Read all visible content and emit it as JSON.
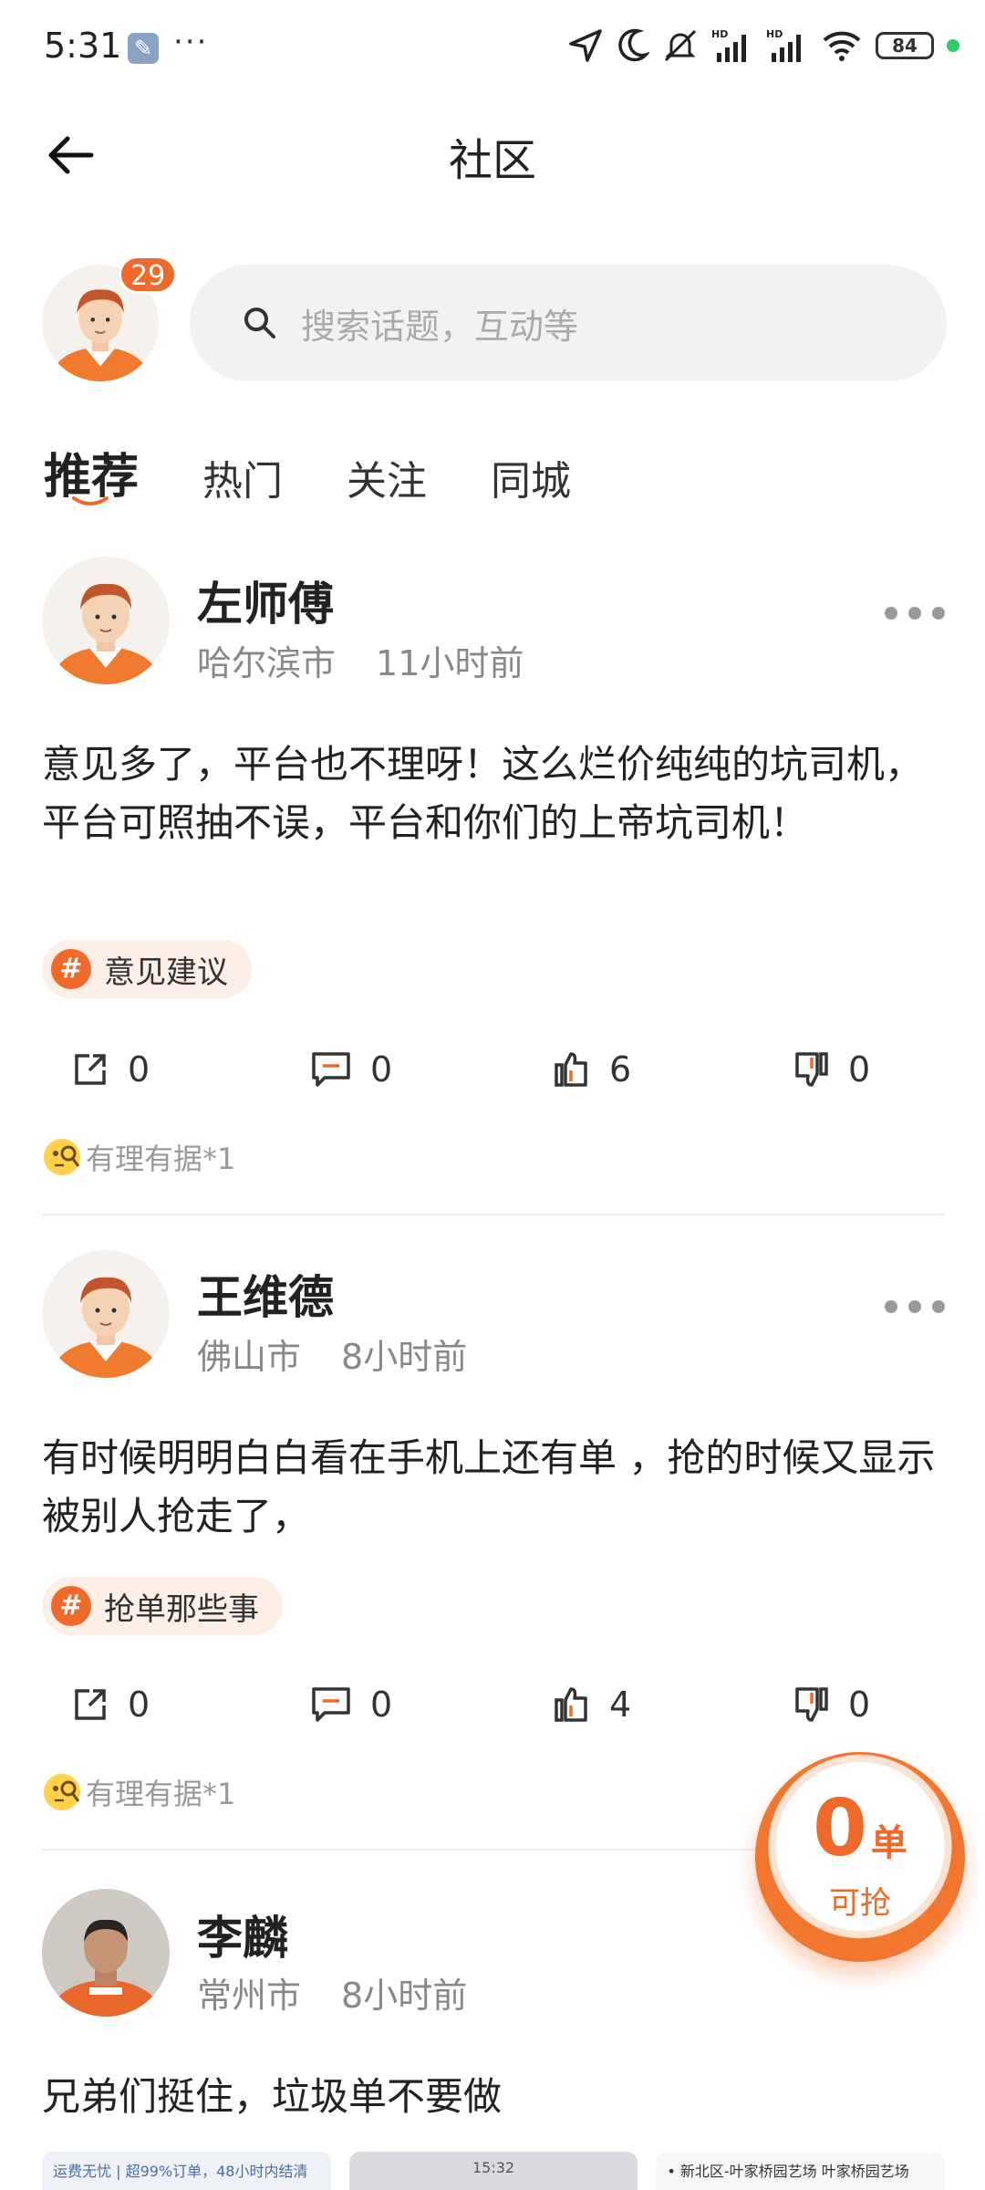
{
  "status_bar": {
    "time": "5:31",
    "dots": "···",
    "battery": "84",
    "icons": [
      "wrench-icon",
      "location-icon",
      "moon-icon",
      "mute-icon",
      "hd-signal-icon",
      "hd-signal-icon",
      "wifi-icon",
      "battery-icon"
    ]
  },
  "header": {
    "title": "社区",
    "back_icon": "back-arrow-icon"
  },
  "profile": {
    "badge_count": "29"
  },
  "search": {
    "placeholder": "搜索话题，互动等"
  },
  "tabs": [
    {
      "label": "推荐",
      "active": true
    },
    {
      "label": "热门",
      "active": false
    },
    {
      "label": "关注",
      "active": false
    },
    {
      "label": "同城",
      "active": false
    }
  ],
  "colors": {
    "accent": "#ef6a2a",
    "topic_bg": "#fdeee6",
    "reaction": "#ffd24a"
  },
  "posts": [
    {
      "name": "左师傅",
      "city": "哈尔滨市",
      "time": "11小时前",
      "body": "意见多了，平台也不理呀！这么烂价纯纯的坑司机，平台可照抽不误，平台和你们的上帝坑司机！",
      "topic": "意见建议",
      "share": "0",
      "comments": "0",
      "likes": "6",
      "dislikes": "0",
      "reaction": "有理有据*1"
    },
    {
      "name": "王维德",
      "city": "佛山市",
      "time": "8小时前",
      "body": "有时候明明白白看在手机上还有单 ，抢的时候又显示被别人抢走了，",
      "topic": "抢单那些事",
      "share": "0",
      "comments": "0",
      "likes": "4",
      "dislikes": "0",
      "reaction": "有理有据*1"
    },
    {
      "name": "李麟",
      "city": "常州市",
      "time": "8小时前",
      "body": "兄弟们挺住，垃圾单不要做"
    }
  ],
  "grab_button": {
    "count": "0",
    "unit": "单",
    "label": "可抢"
  },
  "thumbnails": [
    "运费无忧 | 超99%订单，48小时内结清",
    "15:32",
    "• 新北区-叶家桥园艺场  叶家桥园艺场"
  ]
}
